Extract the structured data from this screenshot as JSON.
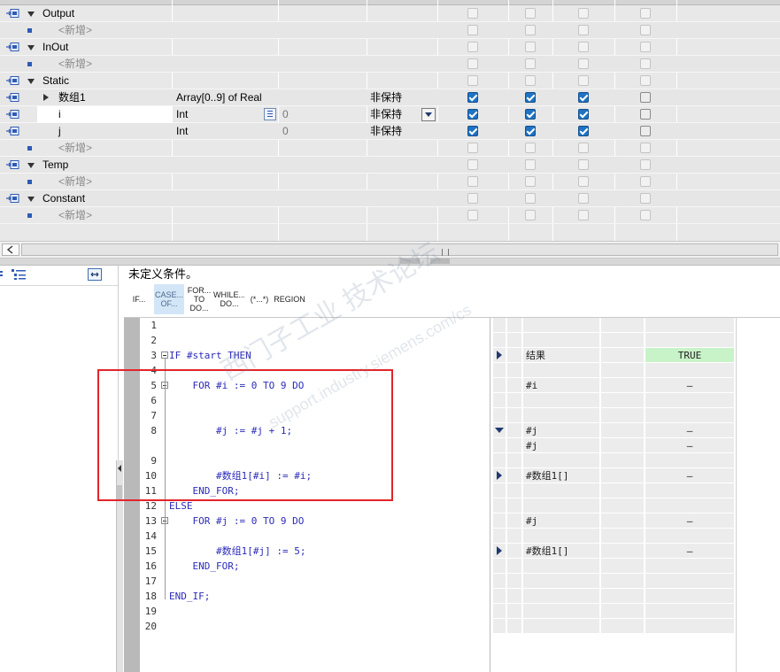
{
  "decl_rows": [
    {
      "kind": "section",
      "name": "Output"
    },
    {
      "kind": "new",
      "name": "<新增>"
    },
    {
      "kind": "section",
      "name": "InOut"
    },
    {
      "kind": "new",
      "name": "<新增>"
    },
    {
      "kind": "section",
      "name": "Static"
    },
    {
      "kind": "var",
      "name": "数组1",
      "expandable": true,
      "type": "Array[0..9] of Real",
      "default": "",
      "retain": "非保持",
      "c1": true,
      "c2": true,
      "c3": true
    },
    {
      "kind": "var",
      "name": "i",
      "expandable": false,
      "type": "Int",
      "default": "0",
      "retain": "非保持",
      "c1": true,
      "c2": true,
      "c3": true,
      "active": true
    },
    {
      "kind": "var",
      "name": "j",
      "expandable": false,
      "type": "Int",
      "default": "0",
      "retain": "非保持",
      "c1": true,
      "c2": true,
      "c3": true
    },
    {
      "kind": "new",
      "name": "<新增>"
    },
    {
      "kind": "section",
      "name": "Temp"
    },
    {
      "kind": "new",
      "name": "<新增>"
    },
    {
      "kind": "section",
      "name": "Constant"
    },
    {
      "kind": "new",
      "name": "<新增>"
    }
  ],
  "condition_text": "未定义条件。",
  "instruction_buttons": [
    {
      "line1": "IF...",
      "line2": ""
    },
    {
      "line1": "CASE...",
      "line2": "OF..."
    },
    {
      "line1": "FOR...",
      "line2": "TO DO..."
    },
    {
      "line1": "WHILE...",
      "line2": "DO..."
    },
    {
      "line1": "(*...*)",
      "line2": ""
    },
    {
      "line1": "REGION",
      "line2": ""
    }
  ],
  "code_lines": [
    {
      "n": "1",
      "text": ""
    },
    {
      "n": "2",
      "text": ""
    },
    {
      "n": "3",
      "text": "IF #start THEN"
    },
    {
      "n": "4",
      "text": ""
    },
    {
      "n": "5",
      "text": "    FOR #i := 0 TO 9 DO"
    },
    {
      "n": "6",
      "text": ""
    },
    {
      "n": "7",
      "text": ""
    },
    {
      "n": "8",
      "text": "        #j := #j + 1;"
    },
    {
      "n": "",
      "text": ""
    },
    {
      "n": "9",
      "text": ""
    },
    {
      "n": "10",
      "text": "        #数组1[#i] := #i;"
    },
    {
      "n": "11",
      "text": "    END_FOR;"
    },
    {
      "n": "12",
      "text": "ELSE"
    },
    {
      "n": "13",
      "text": "    FOR #j := 0 TO 9 DO"
    },
    {
      "n": "14",
      "text": ""
    },
    {
      "n": "15",
      "text": "        #数组1[#j] := 5;"
    },
    {
      "n": "16",
      "text": "    END_FOR;"
    },
    {
      "n": "17",
      "text": ""
    },
    {
      "n": "18",
      "text": "END_IF;"
    },
    {
      "n": "19",
      "text": ""
    },
    {
      "n": "20",
      "text": ""
    }
  ],
  "watch_rows": [
    {
      "mark": "",
      "name": "",
      "value": ""
    },
    {
      "mark": "",
      "name": "",
      "value": ""
    },
    {
      "mark": "right",
      "name": "结果",
      "value": "TRUE",
      "value_bg": "#c8f3c8"
    },
    {
      "mark": "",
      "name": "",
      "value": ""
    },
    {
      "mark": "",
      "name": "#i",
      "value": "–"
    },
    {
      "mark": "",
      "name": "",
      "value": ""
    },
    {
      "mark": "",
      "name": "",
      "value": ""
    },
    {
      "mark": "down",
      "name": "#j",
      "value": "–"
    },
    {
      "mark": "",
      "name": "#j",
      "value": "–"
    },
    {
      "mark": "",
      "name": "",
      "value": ""
    },
    {
      "mark": "right",
      "name": "#数组1[]",
      "value": "–"
    },
    {
      "mark": "",
      "name": "",
      "value": ""
    },
    {
      "mark": "",
      "name": "",
      "value": ""
    },
    {
      "mark": "",
      "name": "#j",
      "value": "–"
    },
    {
      "mark": "",
      "name": "",
      "value": ""
    },
    {
      "mark": "right",
      "name": "#数组1[]",
      "value": "–"
    },
    {
      "mark": "",
      "name": "",
      "value": ""
    },
    {
      "mark": "",
      "name": "",
      "value": ""
    },
    {
      "mark": "",
      "name": "",
      "value": ""
    },
    {
      "mark": "",
      "name": "",
      "value": ""
    },
    {
      "mark": "",
      "name": "",
      "value": ""
    }
  ],
  "watermark": {
    "line1": "西门子工业 技术论坛",
    "line2": "support.industry.siemens.com/cs"
  },
  "colors": {
    "accent": "#1f73c4",
    "highlight": "#e3242b",
    "true_bg": "#c8f3c8"
  }
}
